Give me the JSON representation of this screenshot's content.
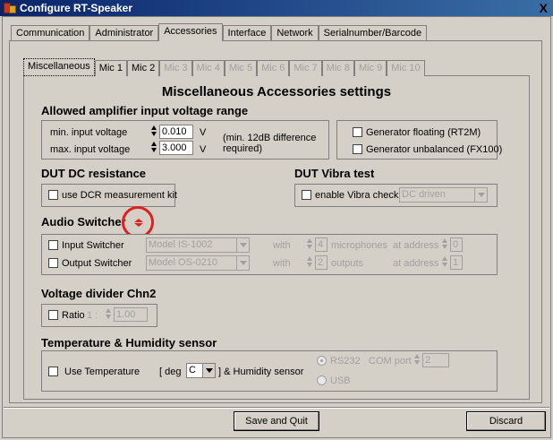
{
  "window": {
    "title": "Configure RT-Speaker",
    "close": "X"
  },
  "tabs": [
    "Communication",
    "Administrator",
    "Accessories",
    "Interface",
    "Network",
    "Serialnumber/Barcode"
  ],
  "subtabs": [
    "Miscellaneous",
    "Mic 1",
    "Mic 2",
    "Mic 3",
    "Mic 4",
    "Mic 5",
    "Mic 6",
    "Mic 7",
    "Mic 8",
    "Mic 9",
    "Mic 10"
  ],
  "panel_title": "Miscellaneous Accessories settings",
  "amp": {
    "heading": "Allowed amplifier input voltage range",
    "min_label": "min. input voltage",
    "min_value": "0.010",
    "max_label": "max. input voltage",
    "max_value": "3.000",
    "unit": "V",
    "note_line1": "(min. 12dB difference",
    "note_line2": "required)",
    "gen_floating": "Generator floating (RT2M)",
    "gen_unbalanced": "Generator unbalanced  (FX100)"
  },
  "dcr": {
    "heading": "DUT DC resistance",
    "check": "use DCR measurement kit"
  },
  "vibra": {
    "heading": "DUT Vibra test",
    "check": "enable Vibra check",
    "combo": "DC driven"
  },
  "audio": {
    "heading": "Audio Switcher",
    "input_label": "Input Switcher",
    "input_model": "Model IS-1002",
    "output_label": "Output Switcher",
    "output_model": "Model OS-0210",
    "with": "with",
    "in_count": "4",
    "in_unit": "microphones",
    "out_count": "2",
    "out_unit": "outputs",
    "at_address": "at address",
    "in_addr": "0",
    "out_addr": "1"
  },
  "divider": {
    "heading": "Voltage divider Chn2",
    "ratio_label": "Ratio",
    "ratio_prefix": "1 :",
    "ratio_value": "1.00"
  },
  "temp": {
    "heading": "Temperature & Humidity sensor",
    "use_label": "Use Temperature",
    "deg_label": "[ deg",
    "unit_value": "C",
    "humid_label": "] & Humidity sensor",
    "rs232": "RS232",
    "com_label": "COM port",
    "com_value": "2",
    "usb": "USB"
  },
  "buttons": {
    "save": "Save and Quit",
    "discard": "Discard"
  }
}
